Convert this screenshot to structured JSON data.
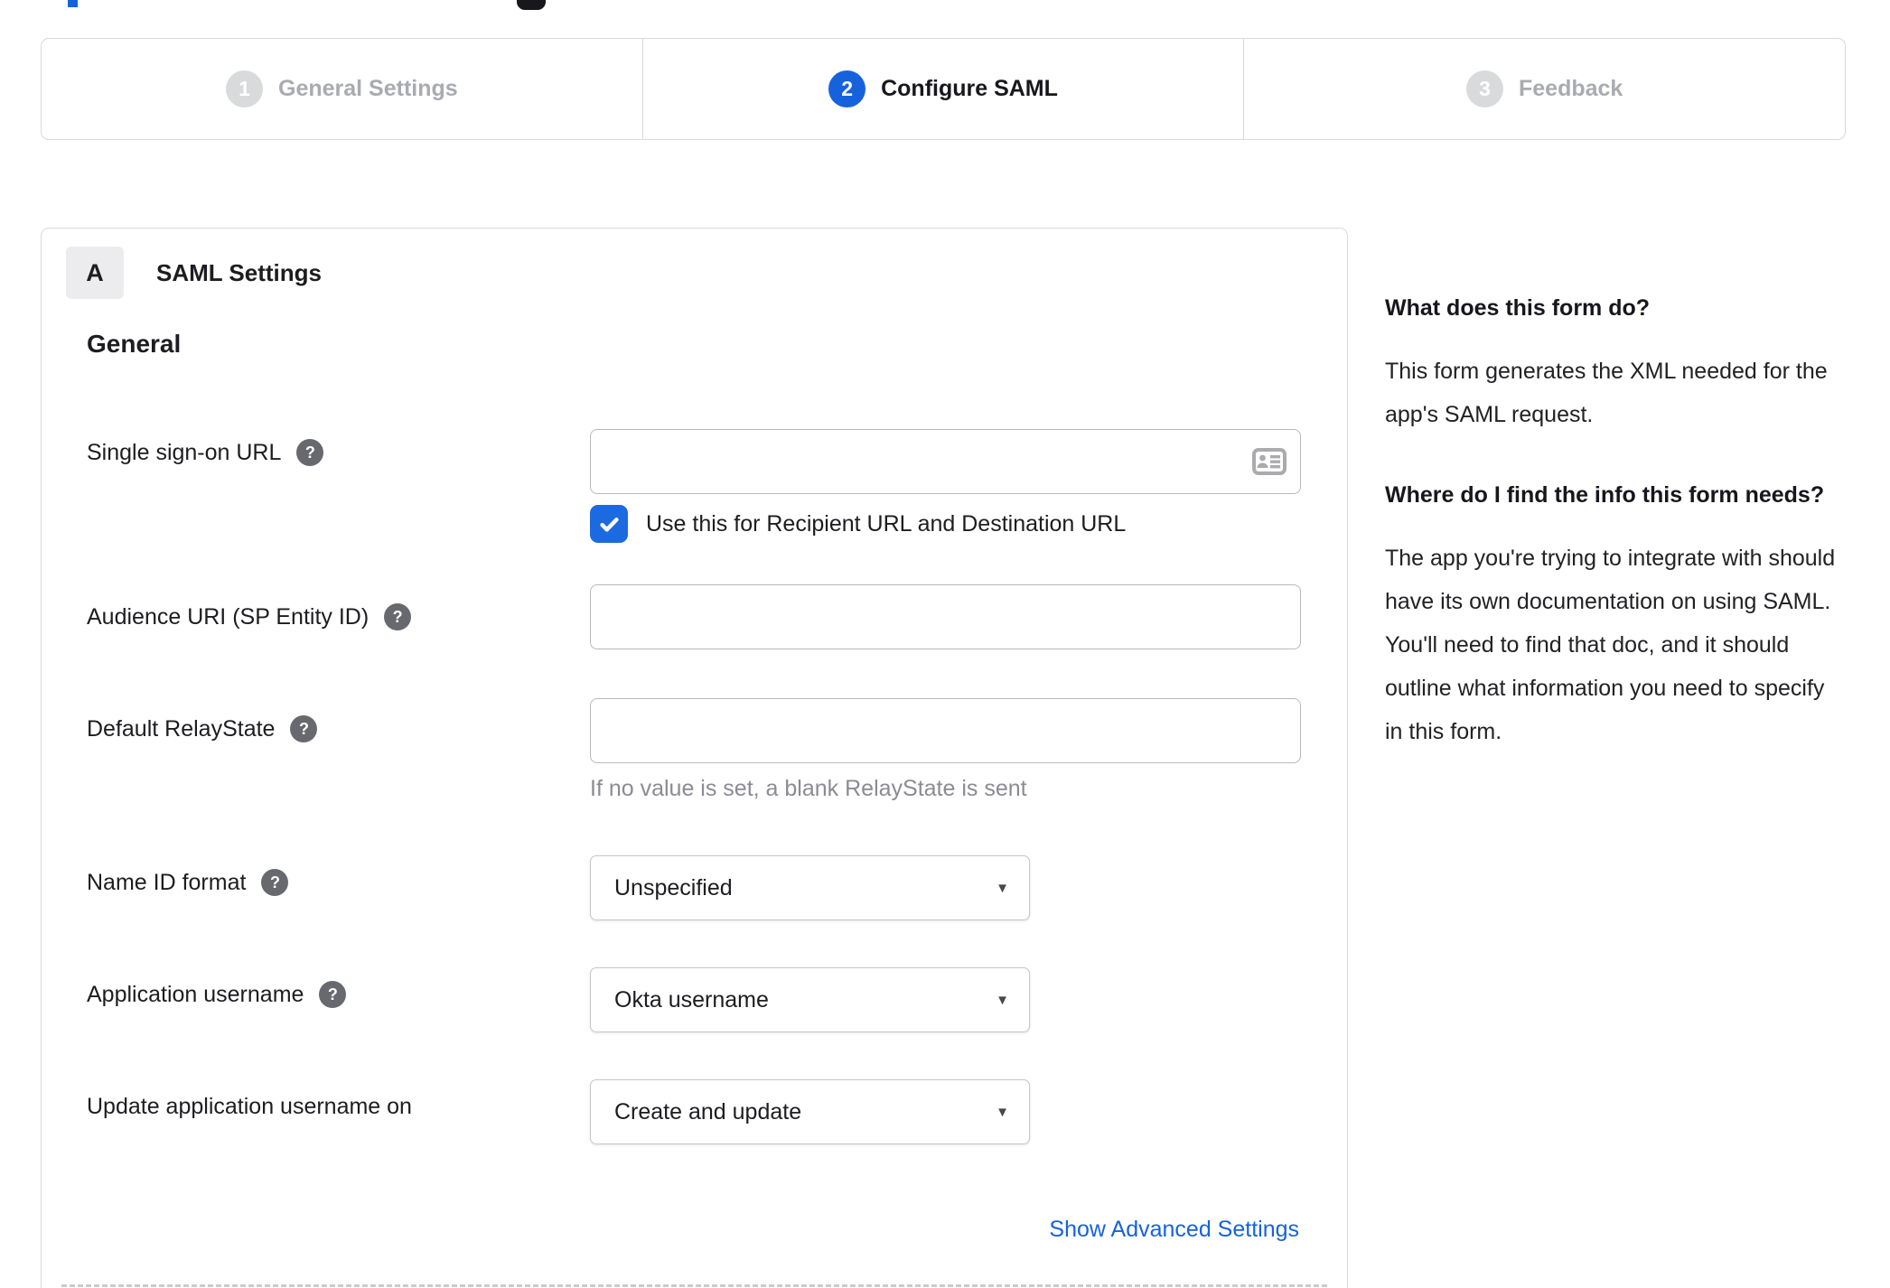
{
  "colors": {
    "accent_blue": "#1662dd"
  },
  "icons": {
    "help": "?",
    "caret": "▼"
  },
  "stepper": {
    "steps": [
      {
        "number": "1",
        "label": "General Settings",
        "state": "completed"
      },
      {
        "number": "2",
        "label": "Configure SAML",
        "state": "active"
      },
      {
        "number": "3",
        "label": "Feedback",
        "state": "upcoming"
      }
    ]
  },
  "panel": {
    "badge": "A",
    "title": "SAML Settings",
    "heading": "General",
    "sso": {
      "label": "Single sign-on URL",
      "value": "",
      "checkbox_label": "Use this for Recipient URL and Destination URL",
      "checkbox_checked": true
    },
    "audience": {
      "label": "Audience URI (SP Entity ID)",
      "value": ""
    },
    "relaystate": {
      "label": "Default RelayState",
      "value": "",
      "hint": "If no value is set, a blank RelayState is sent"
    },
    "nameid": {
      "label": "Name ID format",
      "value": "Unspecified"
    },
    "app_username": {
      "label": "Application username",
      "value": "Okta username"
    },
    "update_username": {
      "label": "Update application username on",
      "value": "Create and update"
    },
    "advanced_link": "Show Advanced Settings"
  },
  "sidebar": {
    "s1_heading": "What does this form do?",
    "s1_body": "This form generates the XML needed for the app's SAML request.",
    "s2_heading": "Where do I find the info this form needs?",
    "s2_body": "The app you're trying to integrate with should have its own documentation on using SAML. You'll need to find that doc, and it should outline what information you need to specify in this form."
  }
}
